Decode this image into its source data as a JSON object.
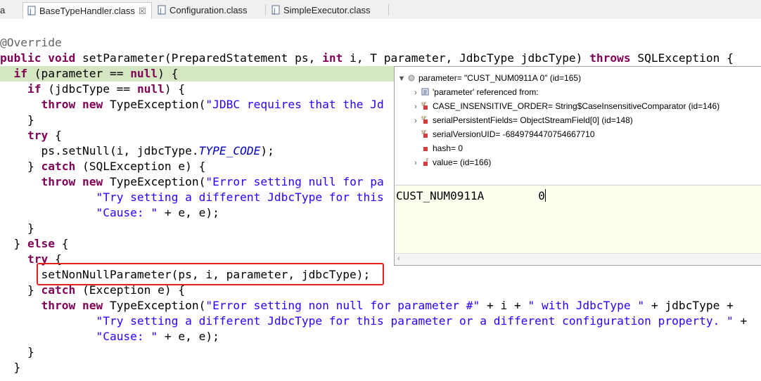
{
  "tabs": [
    {
      "label": "a"
    },
    {
      "label": "BaseTypeHandler.class",
      "close": "☒"
    },
    {
      "label": "Configuration.class"
    },
    {
      "label": "SimpleExecutor.class"
    }
  ],
  "code": {
    "l1": "@Override",
    "l2_kw1": "public",
    "l2_kw2": "void",
    "l2_a": " setParameter(PreparedStatement ps, ",
    "l2_kw3": "int",
    "l2_b": " i, T parameter, JdbcType jdbcType) ",
    "l2_kw4": "throws",
    "l2_c": " SQLException {",
    "l3_kw": "if",
    "l3_a": " (parameter == ",
    "l3_kw2": "null",
    "l3_b": ") {",
    "l4_kw": "if",
    "l4_a": " (jdbcType == ",
    "l4_kw2": "null",
    "l4_b": ") {",
    "l5_kw1": "throw",
    "l5_kw2": "new",
    "l5_a": " TypeException(",
    "l5_str": "\"JDBC requires that the Jd",
    "l6": "}",
    "l7_kw": "try",
    "l7_a": " {",
    "l8_a": "ps.setNull(i, jdbcType.",
    "l8_fld": "TYPE_CODE",
    "l8_b": ");",
    "l9_a": "} ",
    "l9_kw": "catch",
    "l9_b": " (SQLException e) {",
    "l10_kw1": "throw",
    "l10_kw2": "new",
    "l10_a": " TypeException(",
    "l10_str": "\"Error setting null for pa",
    "l11_str": "\"Try setting a different JdbcType for this",
    "l12_str": "\"Cause: \"",
    "l12_a": " + e, e);",
    "l13": "}",
    "l14_a": "} ",
    "l14_kw": "else",
    "l14_b": " {",
    "l15_kw": "try",
    "l15_a": " {",
    "l16": "setNonNullParameter(ps, i, parameter, jdbcType);",
    "l17_a": "} ",
    "l17_kw": "catch",
    "l17_b": " (Exception e) {",
    "l18_kw1": "throw",
    "l18_kw2": "new",
    "l18_a": " TypeException(",
    "l18_str": "\"Error setting non null for parameter #\"",
    "l18_b": " + i + ",
    "l18_str2": "\" with JdbcType \"",
    "l18_c": " + jdbcType + ",
    "l19_str": "\"Try setting a different JdbcType for this parameter or a different configuration property. \"",
    "l19_a": " +",
    "l20_str": "\"Cause: \"",
    "l20_a": " + e, e);",
    "l21": "}",
    "l22": "}"
  },
  "debug": {
    "root": "parameter= \"CUST_NUM0911A      0\" (id=165)",
    "items": [
      "'parameter' referenced from:",
      "CASE_INSENSITIVE_ORDER= String$CaseInsensitiveComparator  (id=146)",
      "serialPersistentFields= ObjectStreamField[0]  (id=148)",
      "serialVersionUID= -6849794470754667710",
      "hash= 0",
      "value= (id=166)"
    ],
    "detail_value": "CUST_NUM0911A        0"
  },
  "colors": {
    "keyword": "#7f0055",
    "string": "#2a00ff",
    "highlight": "#d4e7c2",
    "redbox": "#e0201c"
  }
}
